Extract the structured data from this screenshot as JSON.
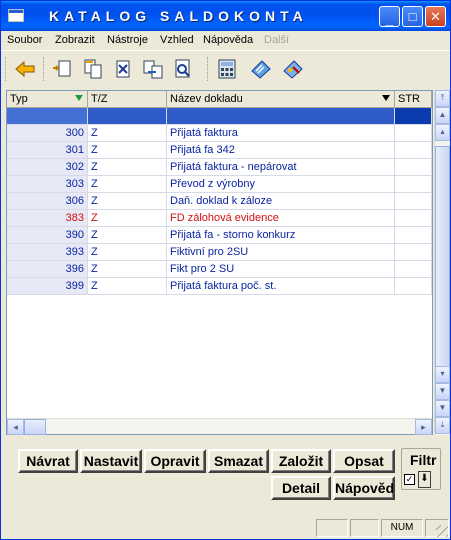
{
  "window": {
    "title": "KATALOG SALDOKONTA",
    "controls": {
      "minimize": "_",
      "maximize": "□",
      "close": "✕"
    }
  },
  "menu": [
    "Soubor",
    "Zobrazit",
    "Nástroje",
    "Vzhled",
    "Nápověda",
    "Další"
  ],
  "toolbar": {
    "icons": [
      "back-arrow-icon",
      "new-record-icon",
      "copy-record-icon",
      "delete-record-icon",
      "move-record-icon",
      "preview-icon",
      "calculator-icon",
      "notebook-icon",
      "wizard-icon"
    ]
  },
  "grid": {
    "columns": [
      "Typ",
      "T/Z",
      "Název dokladu",
      "STR"
    ],
    "rows": [
      {
        "typ": "",
        "tz": "",
        "nazev": "",
        "str": "",
        "selected": true
      },
      {
        "typ": "300",
        "tz": "Z",
        "nazev": "Přijatá faktura",
        "str": ""
      },
      {
        "typ": "301",
        "tz": "Z",
        "nazev": "Přijatá fa 342",
        "str": ""
      },
      {
        "typ": "302",
        "tz": "Z",
        "nazev": "Přijatá faktura - nepárovat",
        "str": ""
      },
      {
        "typ": "303",
        "tz": "Z",
        "nazev": "Převod z výrobny",
        "str": ""
      },
      {
        "typ": "306",
        "tz": "Z",
        "nazev": "Daň. doklad k záloze",
        "str": ""
      },
      {
        "typ": "383",
        "tz": "Z",
        "nazev": "FD zálohová evidence",
        "str": "",
        "red": true
      },
      {
        "typ": "390",
        "tz": "Z",
        "nazev": "Přijatá fa - storno konkurz",
        "str": ""
      },
      {
        "typ": "393",
        "tz": "Z",
        "nazev": "Fiktivní pro 2SU",
        "str": ""
      },
      {
        "typ": "396",
        "tz": "Z",
        "nazev": "Fikt pro 2 SU",
        "str": ""
      },
      {
        "typ": "399",
        "tz": "Z",
        "nazev": "Přijatá faktura poč. st.",
        "str": ""
      }
    ]
  },
  "buttons": {
    "navrat": "Návrat",
    "nastavit": "Nastavit",
    "opravit": "Opravit",
    "smazat": "Smazat",
    "zalozit": "Založit",
    "opsat": "Opsat",
    "detail": "Detail",
    "napoveda": "Nápověd"
  },
  "filter": {
    "label": "Filtr",
    "checked": true
  },
  "status": {
    "panes": [
      "",
      "",
      "NUM",
      ""
    ]
  },
  "colors": {
    "selection": "#2f5cc8",
    "text_blue": "#0a24a0",
    "text_red": "#d21010",
    "titlebar": "#0053ee"
  }
}
